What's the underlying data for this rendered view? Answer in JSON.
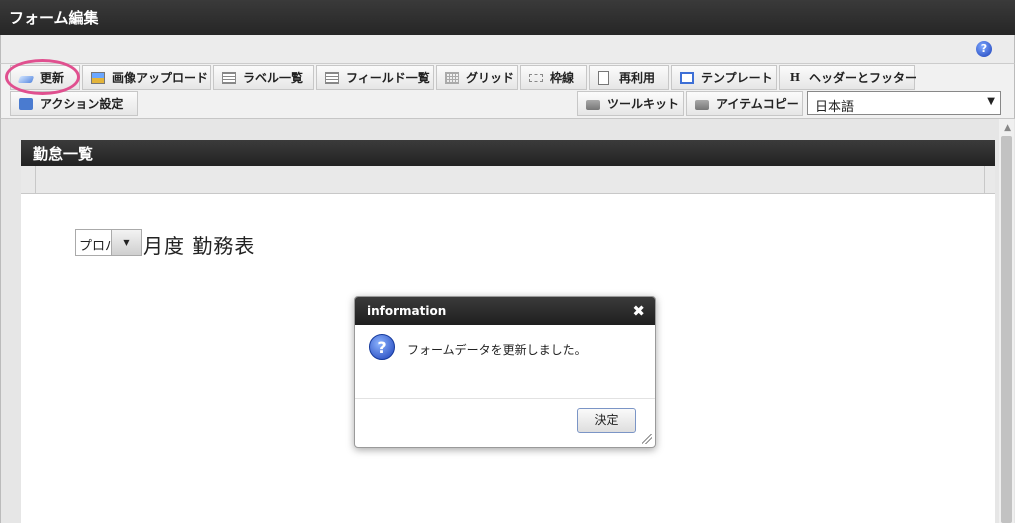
{
  "window": {
    "title": "フォーム編集"
  },
  "toolbar": {
    "row1": [
      {
        "label": "更新",
        "icon": "edit-icon"
      },
      {
        "label": "画像アップロード",
        "icon": "image-upload-icon"
      },
      {
        "label": "ラベル一覧",
        "icon": "label-list-icon"
      },
      {
        "label": "フィールド一覧",
        "icon": "field-list-icon"
      },
      {
        "label": "グリッド",
        "icon": "grid-icon"
      },
      {
        "label": "枠線",
        "icon": "border-icon"
      },
      {
        "label": "再利用",
        "icon": "reuse-icon"
      },
      {
        "label": "テンプレート",
        "icon": "template-icon"
      },
      {
        "label": "ヘッダーとフッター",
        "icon": "header-footer-icon"
      }
    ],
    "row2_left": [
      {
        "label": "アクション設定",
        "icon": "action-icon"
      }
    ],
    "row2_right": [
      {
        "label": "ツールキット",
        "icon": "toolkit-icon"
      },
      {
        "label": "アイテムコピー",
        "icon": "item-copy-icon"
      }
    ],
    "language": {
      "selected": "日本語"
    }
  },
  "form": {
    "title": "勤怠一覧",
    "combo_value": "プロパ",
    "heading": "月度 勤務表"
  },
  "dialog": {
    "title": "information",
    "message": "フォームデータを更新しました。",
    "ok_label": "決定"
  },
  "colors": {
    "highlight": "#e0508f",
    "dark_bar": "#262626"
  }
}
